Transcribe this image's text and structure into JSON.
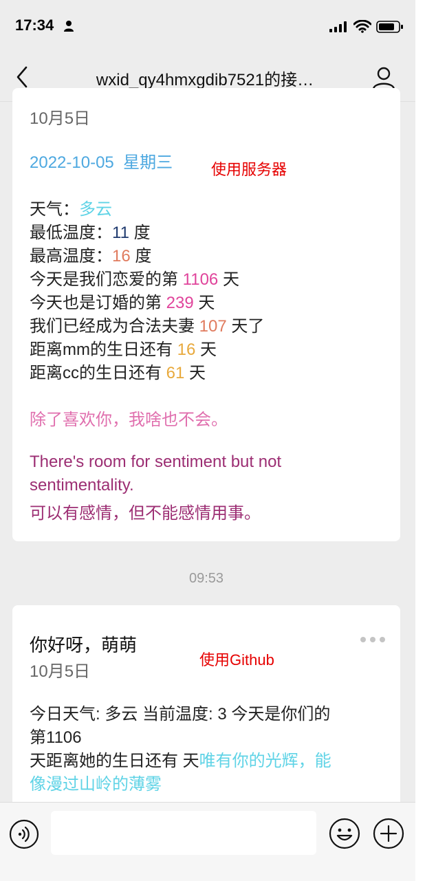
{
  "status_bar": {
    "time": "17:34"
  },
  "nav": {
    "title": "wxid_qy4hmxgdib7521的接…"
  },
  "card1": {
    "date": "10月5日",
    "full_date": "2022-10-05",
    "weekday": "星期三",
    "note": "使用服务器",
    "weather_label": "天气：",
    "weather_value": "多云",
    "low_label": "最低温度：",
    "low_value": "11",
    "high_label": "最高温度：",
    "high_value": "16",
    "degree_unit": "度",
    "love_prefix": "今天是我们恋爱的第",
    "love_value": "1106",
    "day_unit": "天",
    "engaged_prefix": "今天也是订婚的第",
    "engaged_value": "239",
    "married_prefix": "我们已经成为合法夫妻",
    "married_value": "107",
    "married_suffix": "天了",
    "mm_prefix": "距离mm的生日还有",
    "mm_value": "16",
    "cc_prefix": "距离cc的生日还有",
    "cc_value": "61",
    "quote_cn": "除了喜欢你，我啥也不会。",
    "quote_en_1": "There's room for sentiment but not",
    "quote_en_2": "sentimentality.",
    "quote_cn_2": "可以有感情，但不能感情用事。"
  },
  "timestamp": "09:53",
  "card2": {
    "title": "你好呀，萌萌",
    "note": "使用Github",
    "date": "10月5日",
    "line1": "今日天气: 多云 当前温度: 3 今天是你们的",
    "line2": "第1106",
    "line3_plain": "天距离她的生日还有 天",
    "line3_color": "唯有你的光辉，能",
    "line4": "像漫过山岭的薄雾"
  },
  "colors": {
    "accent_blue": "#4da8e0",
    "cyan": "#5fd3e6",
    "pink": "#e0449b",
    "gold": "#e8a93c",
    "magenta": "#9c2e73",
    "red_note": "#e60000"
  },
  "icons": [
    "person-icon",
    "signal-icon",
    "wifi-icon",
    "battery-icon",
    "back-chevron-icon",
    "profile-icon",
    "more-dots-icon",
    "voice-icon",
    "emoji-icon",
    "plus-icon"
  ]
}
